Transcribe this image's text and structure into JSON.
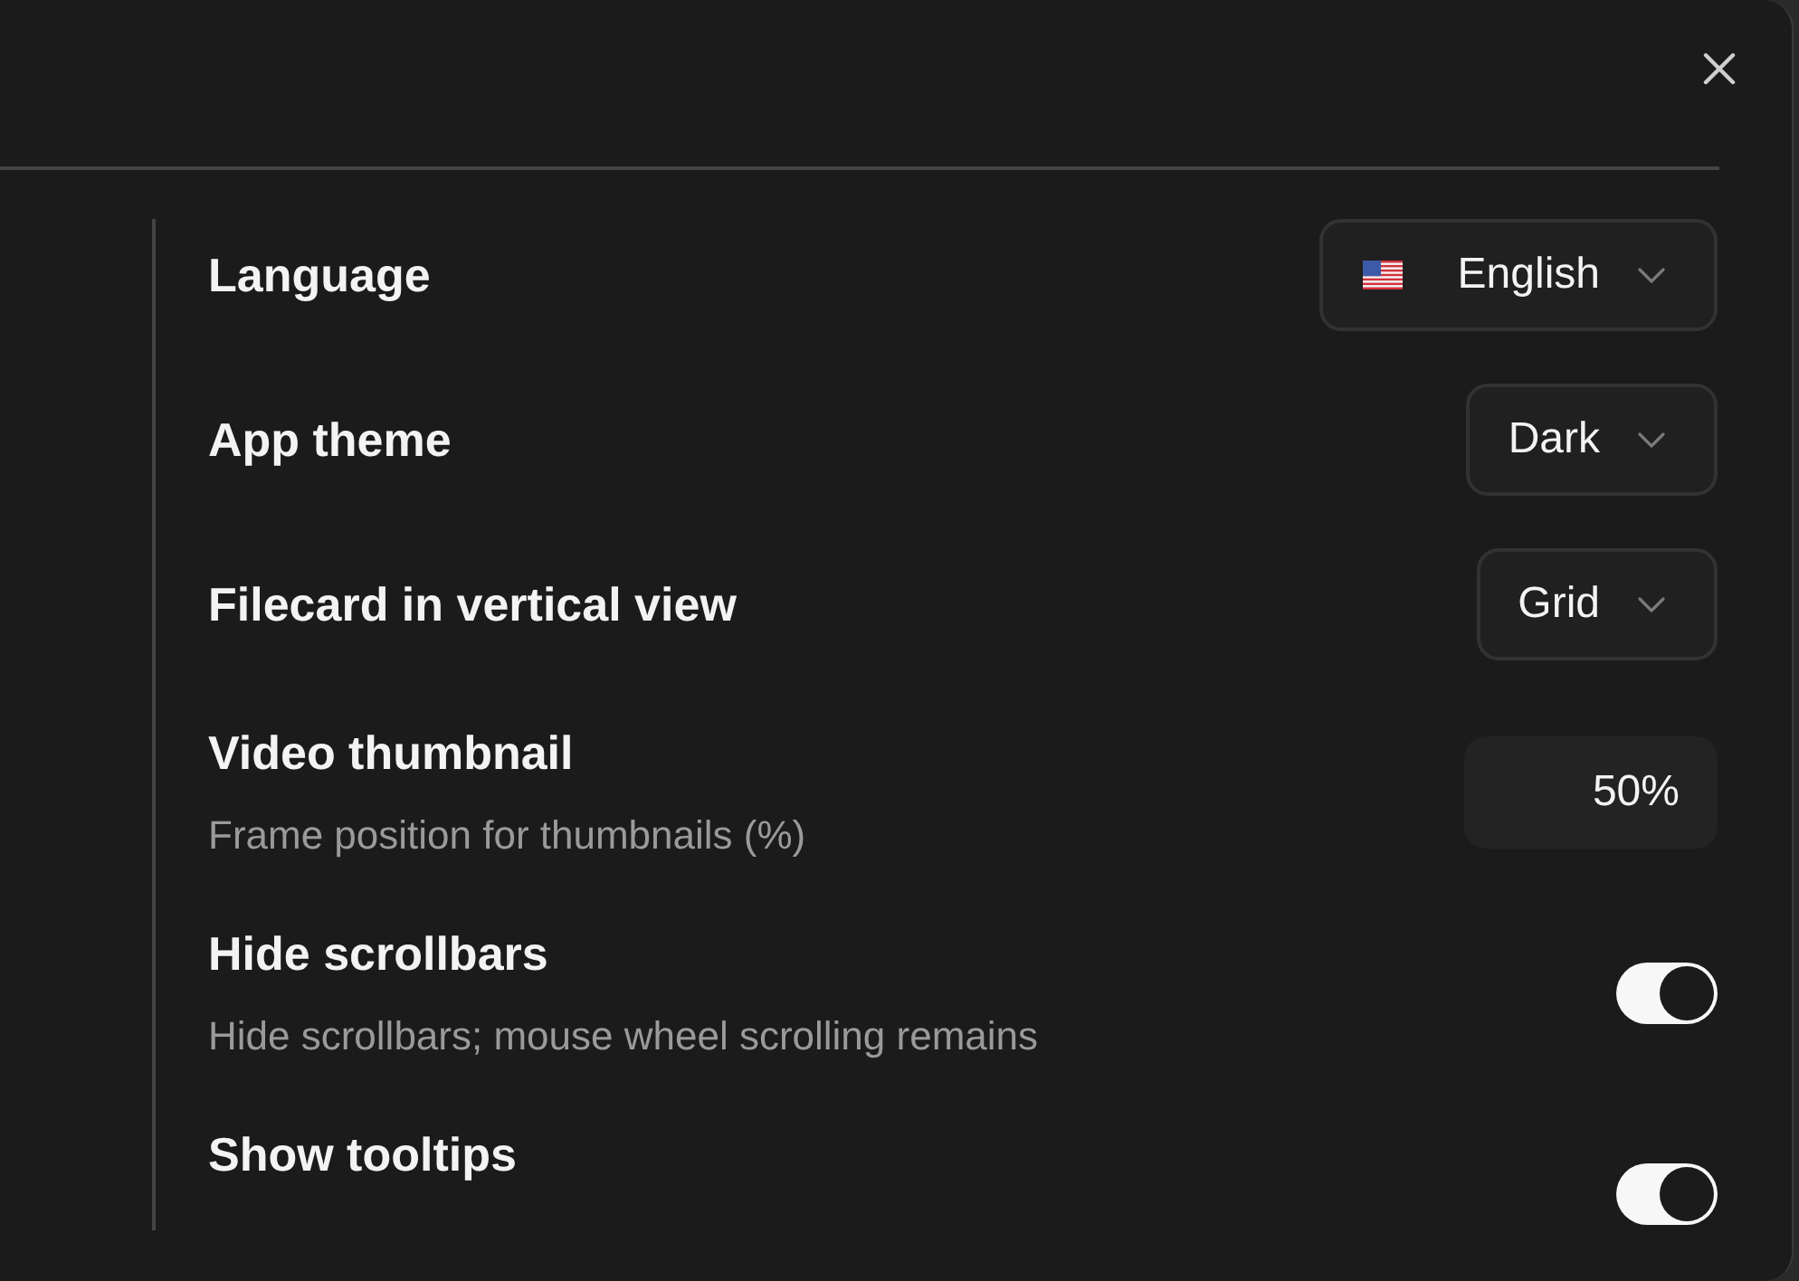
{
  "settings": [
    {
      "kind": "language",
      "label": "Language",
      "value": "English"
    },
    {
      "kind": "select",
      "label": "App theme",
      "value": "Dark"
    },
    {
      "kind": "select",
      "label": "Filecard in vertical view",
      "value": "Grid"
    },
    {
      "kind": "number",
      "label": "Video thumbnail",
      "description": "Frame position for thumbnails (%)",
      "value": "50%"
    },
    {
      "kind": "toggle",
      "label": "Hide scrollbars",
      "description": "Hide scrollbars; mouse wheel scrolling remains",
      "on": true
    },
    {
      "kind": "toggle",
      "label": "Show tooltips",
      "on": true
    }
  ]
}
